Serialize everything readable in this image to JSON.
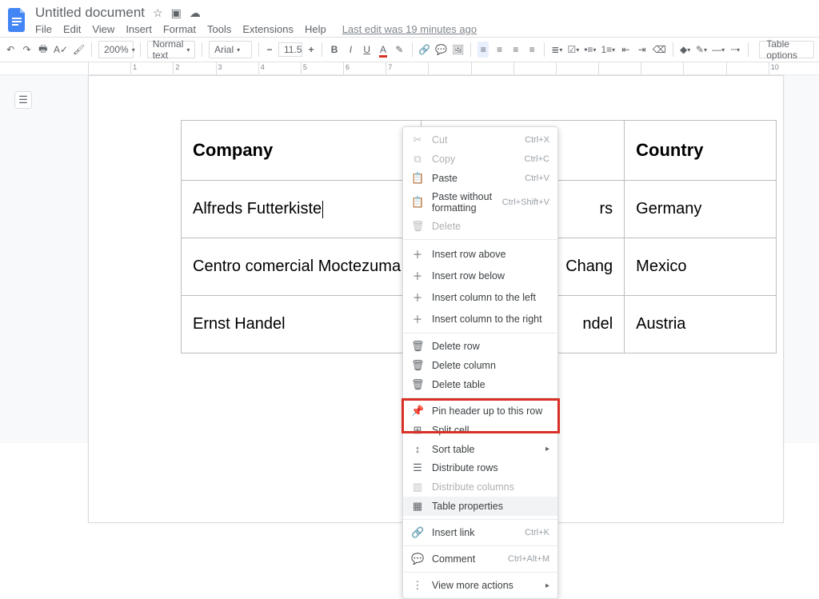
{
  "header": {
    "product_icon": "docs",
    "title": "Untitled document",
    "edit_status": "Last edit was 19 minutes ago",
    "menu": [
      "File",
      "Edit",
      "View",
      "Insert",
      "Format",
      "Tools",
      "Extensions",
      "Help"
    ]
  },
  "toolbar": {
    "zoom": "200%",
    "paragraph_style": "Normal text",
    "font": "Arial",
    "font_size": "11.5",
    "table_options": "Table options"
  },
  "ruler": {
    "labels": [
      "",
      "1",
      "2",
      "3",
      "4",
      "5",
      "6",
      "7",
      "",
      "",
      "",
      "",
      "",
      "",
      "",
      "",
      "",
      "10"
    ]
  },
  "table": {
    "headers": [
      "Company",
      "",
      "Country"
    ],
    "rows": [
      [
        "Alfreds Futterkiste",
        "rs",
        "Germany"
      ],
      [
        "Centro comercial Moctezuma",
        "Chang",
        "Mexico"
      ],
      [
        "Ernst Handel",
        "ndel",
        "Austria"
      ]
    ]
  },
  "context_menu": {
    "shortcuts": {
      "cut": "Ctrl+X",
      "copy": "Ctrl+C",
      "paste": "Ctrl+V",
      "pwf": "Ctrl+Shift+V",
      "link": "Ctrl+K",
      "comment": "Ctrl+Alt+M"
    },
    "items": {
      "cut": "Cut",
      "copy": "Copy",
      "paste": "Paste",
      "pwf": "Paste without formatting",
      "del": "Delete",
      "ira": "Insert row above",
      "irb": "Insert row below",
      "icl": "Insert column to the left",
      "icr": "Insert column to the right",
      "drow": "Delete row",
      "dcol": "Delete column",
      "dtab": "Delete table",
      "pin": "Pin header up to this row",
      "split": "Split cell",
      "sort": "Sort table",
      "drows": "Distribute rows",
      "dcols": "Distribute columns",
      "tprop": "Table properties",
      "link": "Insert link",
      "comment": "Comment",
      "more": "View more actions"
    }
  }
}
